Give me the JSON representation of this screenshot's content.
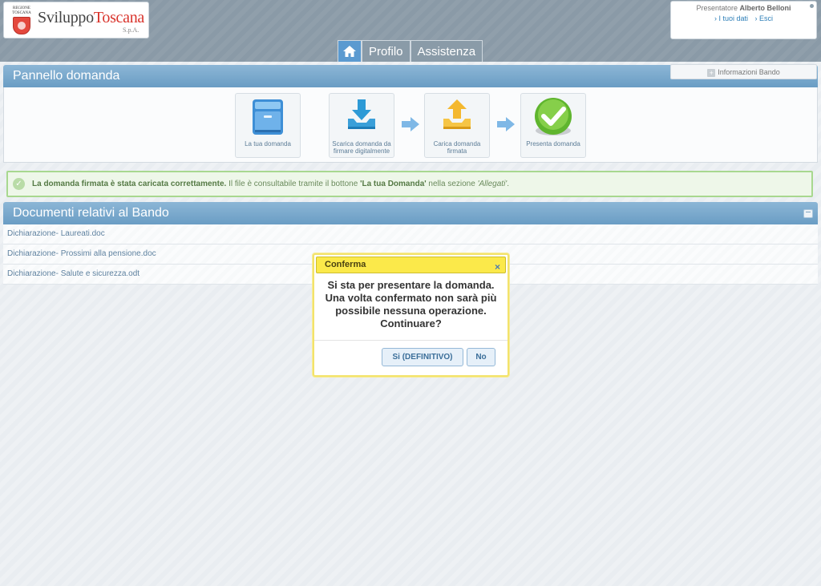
{
  "header": {
    "logo_region": "REGIONE TOSCANA",
    "logo_main": "Sviluppo",
    "logo_accent": "Toscana",
    "logo_sub": "S.p.A.",
    "user_prefix": "Presentatore",
    "user_name": "Alberto Belloni",
    "link_data": "› I tuoi dati",
    "link_exit": "› Esci"
  },
  "nav": {
    "home_icon": "home-icon",
    "tabs": [
      {
        "label": "Profilo"
      },
      {
        "label": "Assistenza"
      }
    ]
  },
  "panel": {
    "title": "Pannello domanda",
    "info_bando": "Informazioni Bando",
    "steps": [
      {
        "label": "La tua domanda",
        "icon": "cabinet-icon"
      },
      {
        "label": "Scarica domanda da firmare digitalmente",
        "icon": "download-icon"
      },
      {
        "label": "Carica domanda firmata",
        "icon": "upload-icon"
      },
      {
        "label": "Presenta domanda",
        "icon": "checkmark-icon"
      }
    ]
  },
  "notice": {
    "bold": "La domanda firmata è stata caricata correttamente.",
    "text1": " Il file è consultabile tramite il bottone ",
    "button_ref": "'La tua Domanda'",
    "text2": " nella sezione ",
    "section_ref": "'Allegati'",
    "text3": "."
  },
  "documents": {
    "title": "Documenti relativi al Bando",
    "items": [
      {
        "name": "Dichiarazione- Laureati.doc"
      },
      {
        "name": "Dichiarazione- Prossimi alla pensione.doc"
      },
      {
        "name": "Dichiarazione- Salute e sicurezza.odt"
      }
    ]
  },
  "dialog": {
    "title": "Conferma",
    "close": "×",
    "message": "Si sta per presentare la domanda. Una volta confermato non sarà più possibile nessuna operazione. Continuare?",
    "confirm": "Si (DEFINITIVO)",
    "cancel": "No"
  },
  "colors": {
    "header_bg": "#8a9aa7",
    "panel_head": "#6a9dc4",
    "dialog_title": "#fbe94a",
    "notice_border": "#a8d88f",
    "link": "#5f82a0"
  }
}
